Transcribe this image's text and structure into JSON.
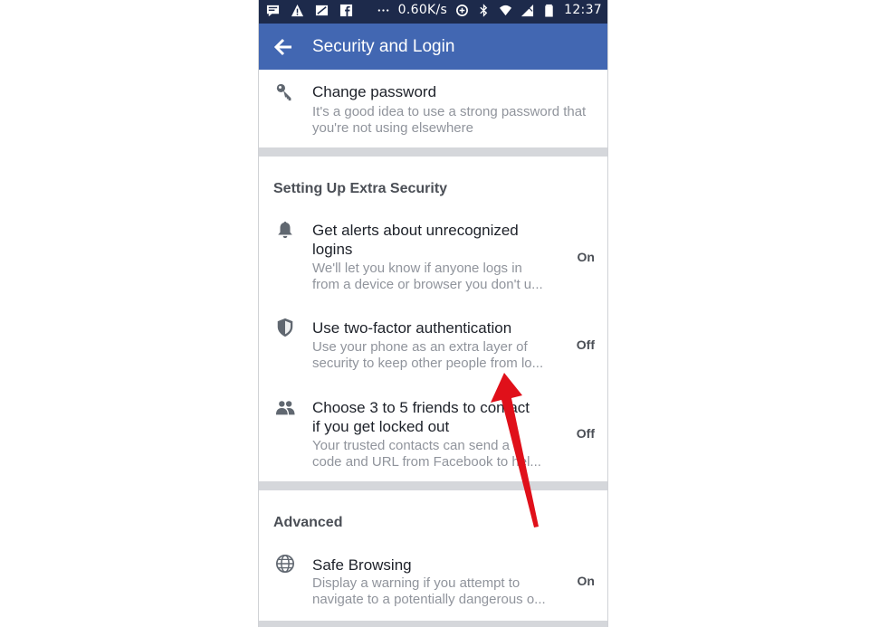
{
  "status_bar": {
    "speed": "0.60K/s",
    "time": "12:37",
    "icons": [
      "message-icon",
      "warning-icon",
      "no-sim-icon",
      "facebook-icon",
      "more-dots-icon",
      "data-saver-icon",
      "bluetooth-icon",
      "wifi-icon",
      "signal-icon",
      "battery-icon"
    ]
  },
  "appbar": {
    "title": "Security and Login",
    "back_icon": "back-arrow-icon"
  },
  "change_password": {
    "title": "Change password",
    "subtitle_line1": "It's a good idea to use a strong password that",
    "subtitle_line2": "you're not using elsewhere",
    "icon": "key-icon"
  },
  "extra_security": {
    "heading": "Setting Up Extra Security",
    "items": [
      {
        "title_line1": "Get alerts about unrecognized",
        "title_line2": "logins",
        "subtitle_line1": "We'll let you know if anyone logs in",
        "subtitle_line2": "from a device or browser you don't u...",
        "status": "On",
        "icon": "bell-icon"
      },
      {
        "title_line1": "Use two-factor authentication",
        "subtitle_line1": "Use your phone as an extra layer of",
        "subtitle_line2": "security to keep other people from lo...",
        "status": "Off",
        "icon": "shield-icon"
      },
      {
        "title_line1": "Choose 3 to 5 friends to contact",
        "title_line2": "if you get locked out",
        "subtitle_line1": "Your trusted contacts can send a",
        "subtitle_line2": "code and URL from Facebook to hel...",
        "status": "Off",
        "icon": "friends-icon"
      }
    ]
  },
  "advanced": {
    "heading": "Advanced",
    "items": [
      {
        "title_line1": "Safe Browsing",
        "subtitle_line1": "Display a warning if you attempt to",
        "subtitle_line2": "navigate to a potentially dangerous o...",
        "status": "On",
        "icon": "globe-icon"
      }
    ]
  },
  "colors": {
    "status_bar": "#1d2a4b",
    "app_bar": "#4267b2",
    "annotation_arrow": "#e0101a"
  }
}
